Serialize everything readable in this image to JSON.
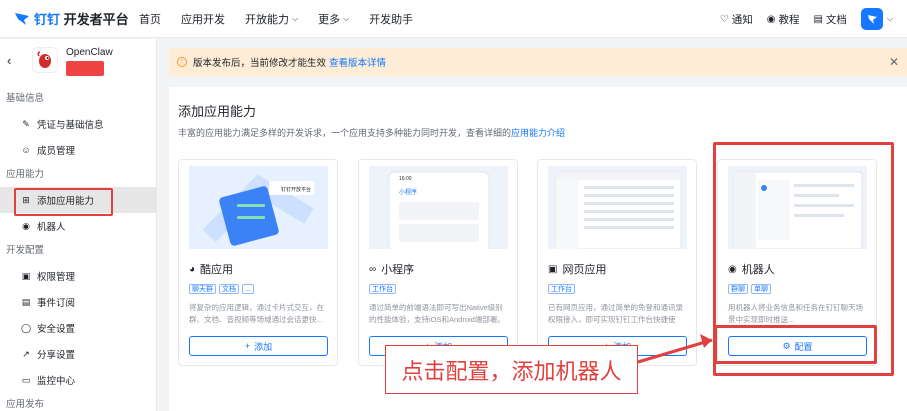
{
  "topnav": {
    "brand_prefix": "钉钉",
    "brand_suffix": " 开发者平台",
    "items": [
      {
        "label": "首页",
        "chevron": false
      },
      {
        "label": "应用开发",
        "chevron": false
      },
      {
        "label": "开放能力",
        "chevron": true
      },
      {
        "label": "更多",
        "chevron": true
      },
      {
        "label": "开发助手",
        "chevron": false
      }
    ],
    "right": {
      "notify": "通知",
      "tutorial": "教程",
      "docs": "文档"
    }
  },
  "sidebar": {
    "app_name": "OpenClaw",
    "sections": {
      "basic": "基础信息",
      "capability": "应用能力",
      "dev_config": "开发配置",
      "publish": "应用发布"
    },
    "items": {
      "credentials": "凭证与基础信息",
      "members": "成员管理",
      "add_capability": "添加应用能力",
      "robot": "机器人",
      "permissions": "权限管理",
      "events": "事件订阅",
      "security": "安全设置",
      "share": "分享设置",
      "monitor": "监控中心"
    }
  },
  "notice": {
    "text": "版本发布后，当前修改才能生效",
    "link": "查看版本详情"
  },
  "panel": {
    "title": "添加应用能力",
    "desc": "丰富的应用能力满足多样的开发诉求，一个应用支持多种能力同时开发，查看详细的",
    "desc_link": "应用能力介绍"
  },
  "cards": [
    {
      "name": "酷应用",
      "tags": [
        "聊天群",
        "文档",
        "..."
      ],
      "desc": "将复杂的应用逻辑，通过卡片式交互，在群、文档、音视频等场域通过会话更快...",
      "button": "添加",
      "icon": "cool-app-icon"
    },
    {
      "name": "小程序",
      "tags": [
        "工作台"
      ],
      "desc": "通过简单的前端语法即可写出Native级别的性能体验，支持iOS和Android端部署。",
      "button": "添加",
      "icon": "miniapp-icon"
    },
    {
      "name": "网页应用",
      "tags": [
        "工作台"
      ],
      "desc": "已有网页应用，通过简单的免登和通讯录权限接入，即可实现钉钉工作台快捷使用。",
      "button": "添加",
      "icon": "webapp-icon"
    },
    {
      "name": "机器人",
      "tags": [
        "群聊",
        "单聊"
      ],
      "desc": "用机器人将业务信息和任务在钉钉聊天场景中实现即时推送...",
      "button": "配置",
      "icon": "robot-icon"
    }
  ],
  "thumbs": {
    "miniapp_title": "小程序",
    "miniapp_time": "16:00",
    "coolapp_caption": "钉钉开放平台"
  },
  "annotation": {
    "text": "点击配置，添加机器人",
    "color": "#e0413e"
  },
  "colors": {
    "accent": "#1677ff",
    "annotation": "#e0413e",
    "notice_bg": "#fdecd6"
  }
}
